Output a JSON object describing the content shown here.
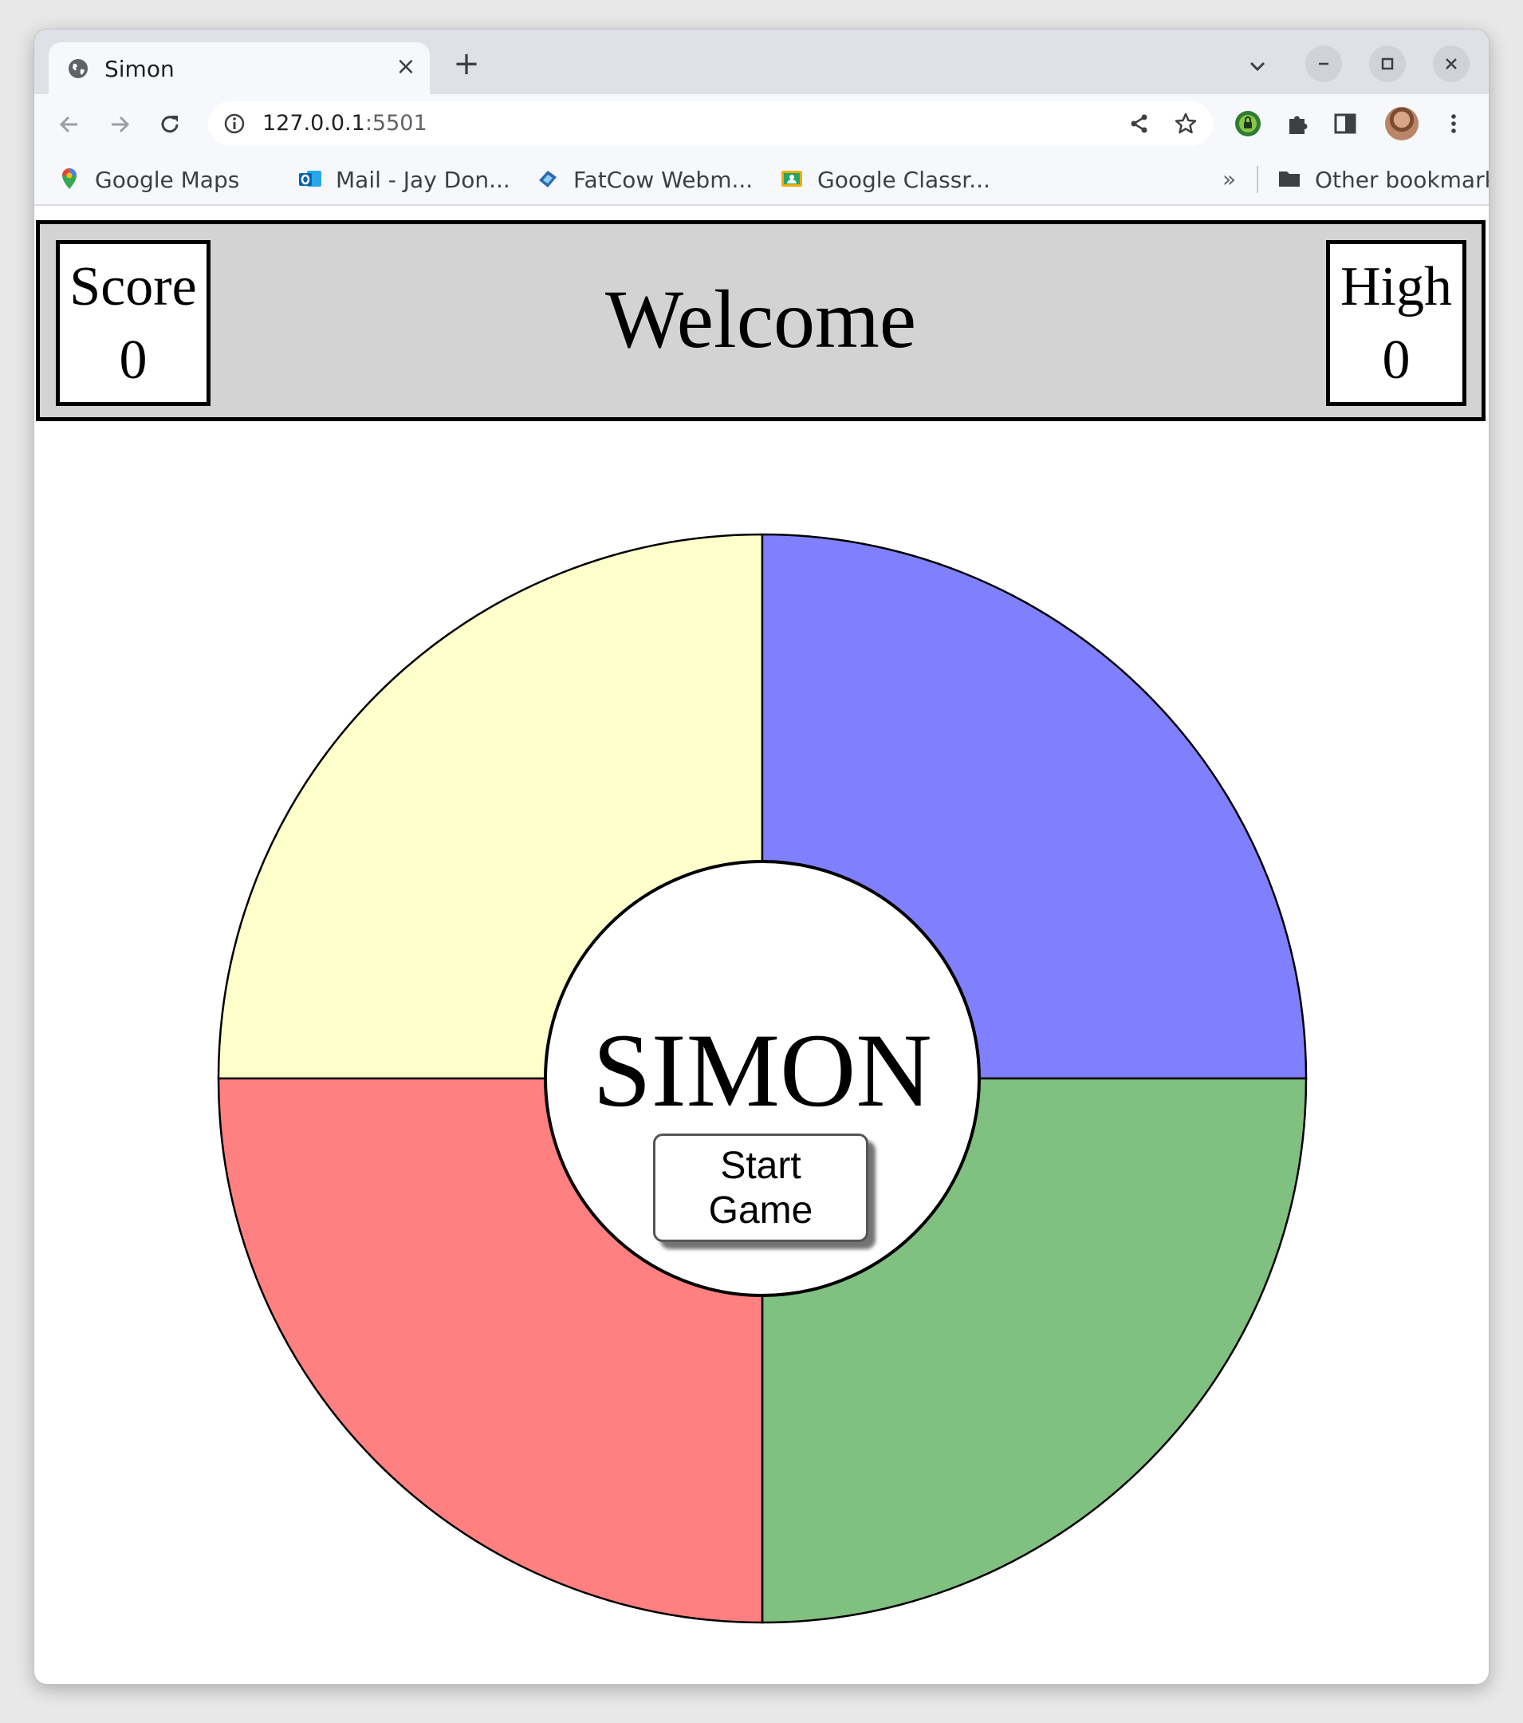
{
  "browser": {
    "tab_title": "Simon",
    "new_tab_symbol": "+",
    "close_tab_symbol": "×",
    "url_host": "127.0.0.1",
    "url_port": ":5501",
    "bookmarks": [
      {
        "label": "Google Maps",
        "icon": "google-maps-icon"
      },
      {
        "label": "Mail - Jay Don...",
        "icon": "outlook-icon"
      },
      {
        "label": "FatCow Webm...",
        "icon": "fatcow-icon"
      },
      {
        "label": "Google Classr...",
        "icon": "google-classroom-icon"
      }
    ],
    "bookmarks_overflow": "»",
    "other_bookmarks": "Other bookmarks"
  },
  "header": {
    "score_label": "Score",
    "score_value": "0",
    "title": "Welcome",
    "high_label": "High",
    "high_value": "0"
  },
  "board": {
    "title": "SIMON",
    "start_line1": "Start",
    "start_line2": "Game",
    "colors": {
      "top_left": "#ffffcc",
      "top_right": "#8080ff",
      "bottom_left": "#ff8080",
      "bottom_right": "#80c080"
    }
  }
}
